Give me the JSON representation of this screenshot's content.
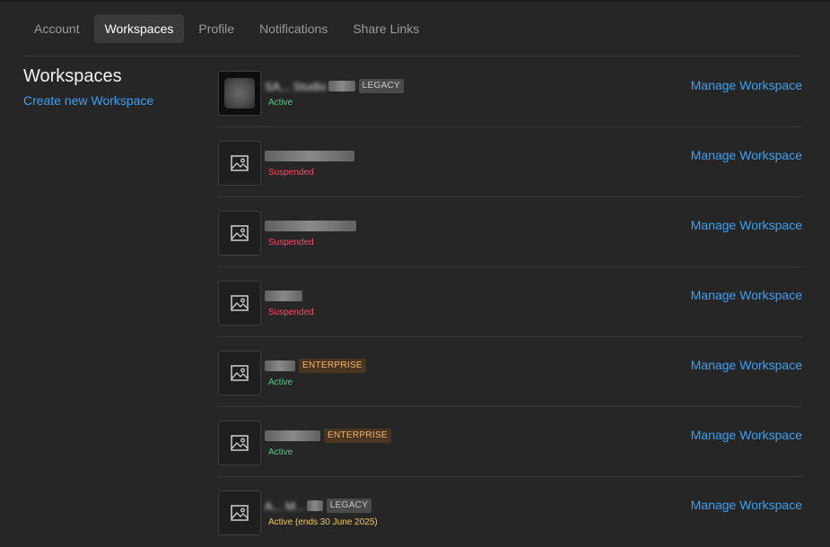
{
  "tabs": [
    {
      "label": "Account"
    },
    {
      "label": "Workspaces"
    },
    {
      "label": "Profile"
    },
    {
      "label": "Notifications"
    },
    {
      "label": "Share Links"
    }
  ],
  "sidebar": {
    "title": "Workspaces",
    "create_link": "Create new Workspace"
  },
  "colors": {
    "link": "#3aa0f2",
    "active_status": "#4cc98a",
    "suspended_status": "#ff4668",
    "ending_status": "#f2c84b",
    "enterprise_badge_text": "#f0b66a"
  },
  "workspaces": [
    {
      "name": "SA... Studio",
      "badge": "LEGACY",
      "status": "Active",
      "manage_label": "Manage Workspace",
      "thumb_icon": "photo-thumbnail"
    },
    {
      "name": "",
      "badge": "",
      "status": "Suspended",
      "manage_label": "Manage Workspace",
      "thumb_icon": "image-placeholder-icon"
    },
    {
      "name": "",
      "badge": "",
      "status": "Suspended",
      "manage_label": "Manage Workspace",
      "thumb_icon": "image-placeholder-icon"
    },
    {
      "name": "",
      "badge": "",
      "status": "Suspended",
      "manage_label": "Manage Workspace",
      "thumb_icon": "image-placeholder-icon"
    },
    {
      "name": "",
      "badge": "ENTERPRISE",
      "status": "Active",
      "manage_label": "Manage Workspace",
      "thumb_icon": "image-placeholder-icon"
    },
    {
      "name": "",
      "badge": "ENTERPRISE",
      "status": "Active",
      "manage_label": "Manage Workspace",
      "thumb_icon": "image-placeholder-icon"
    },
    {
      "name": "A... M...",
      "badge": "LEGACY",
      "status": "Active (ends 30 June 2025)",
      "manage_label": "Manage Workspace",
      "thumb_icon": "image-placeholder-icon"
    }
  ]
}
